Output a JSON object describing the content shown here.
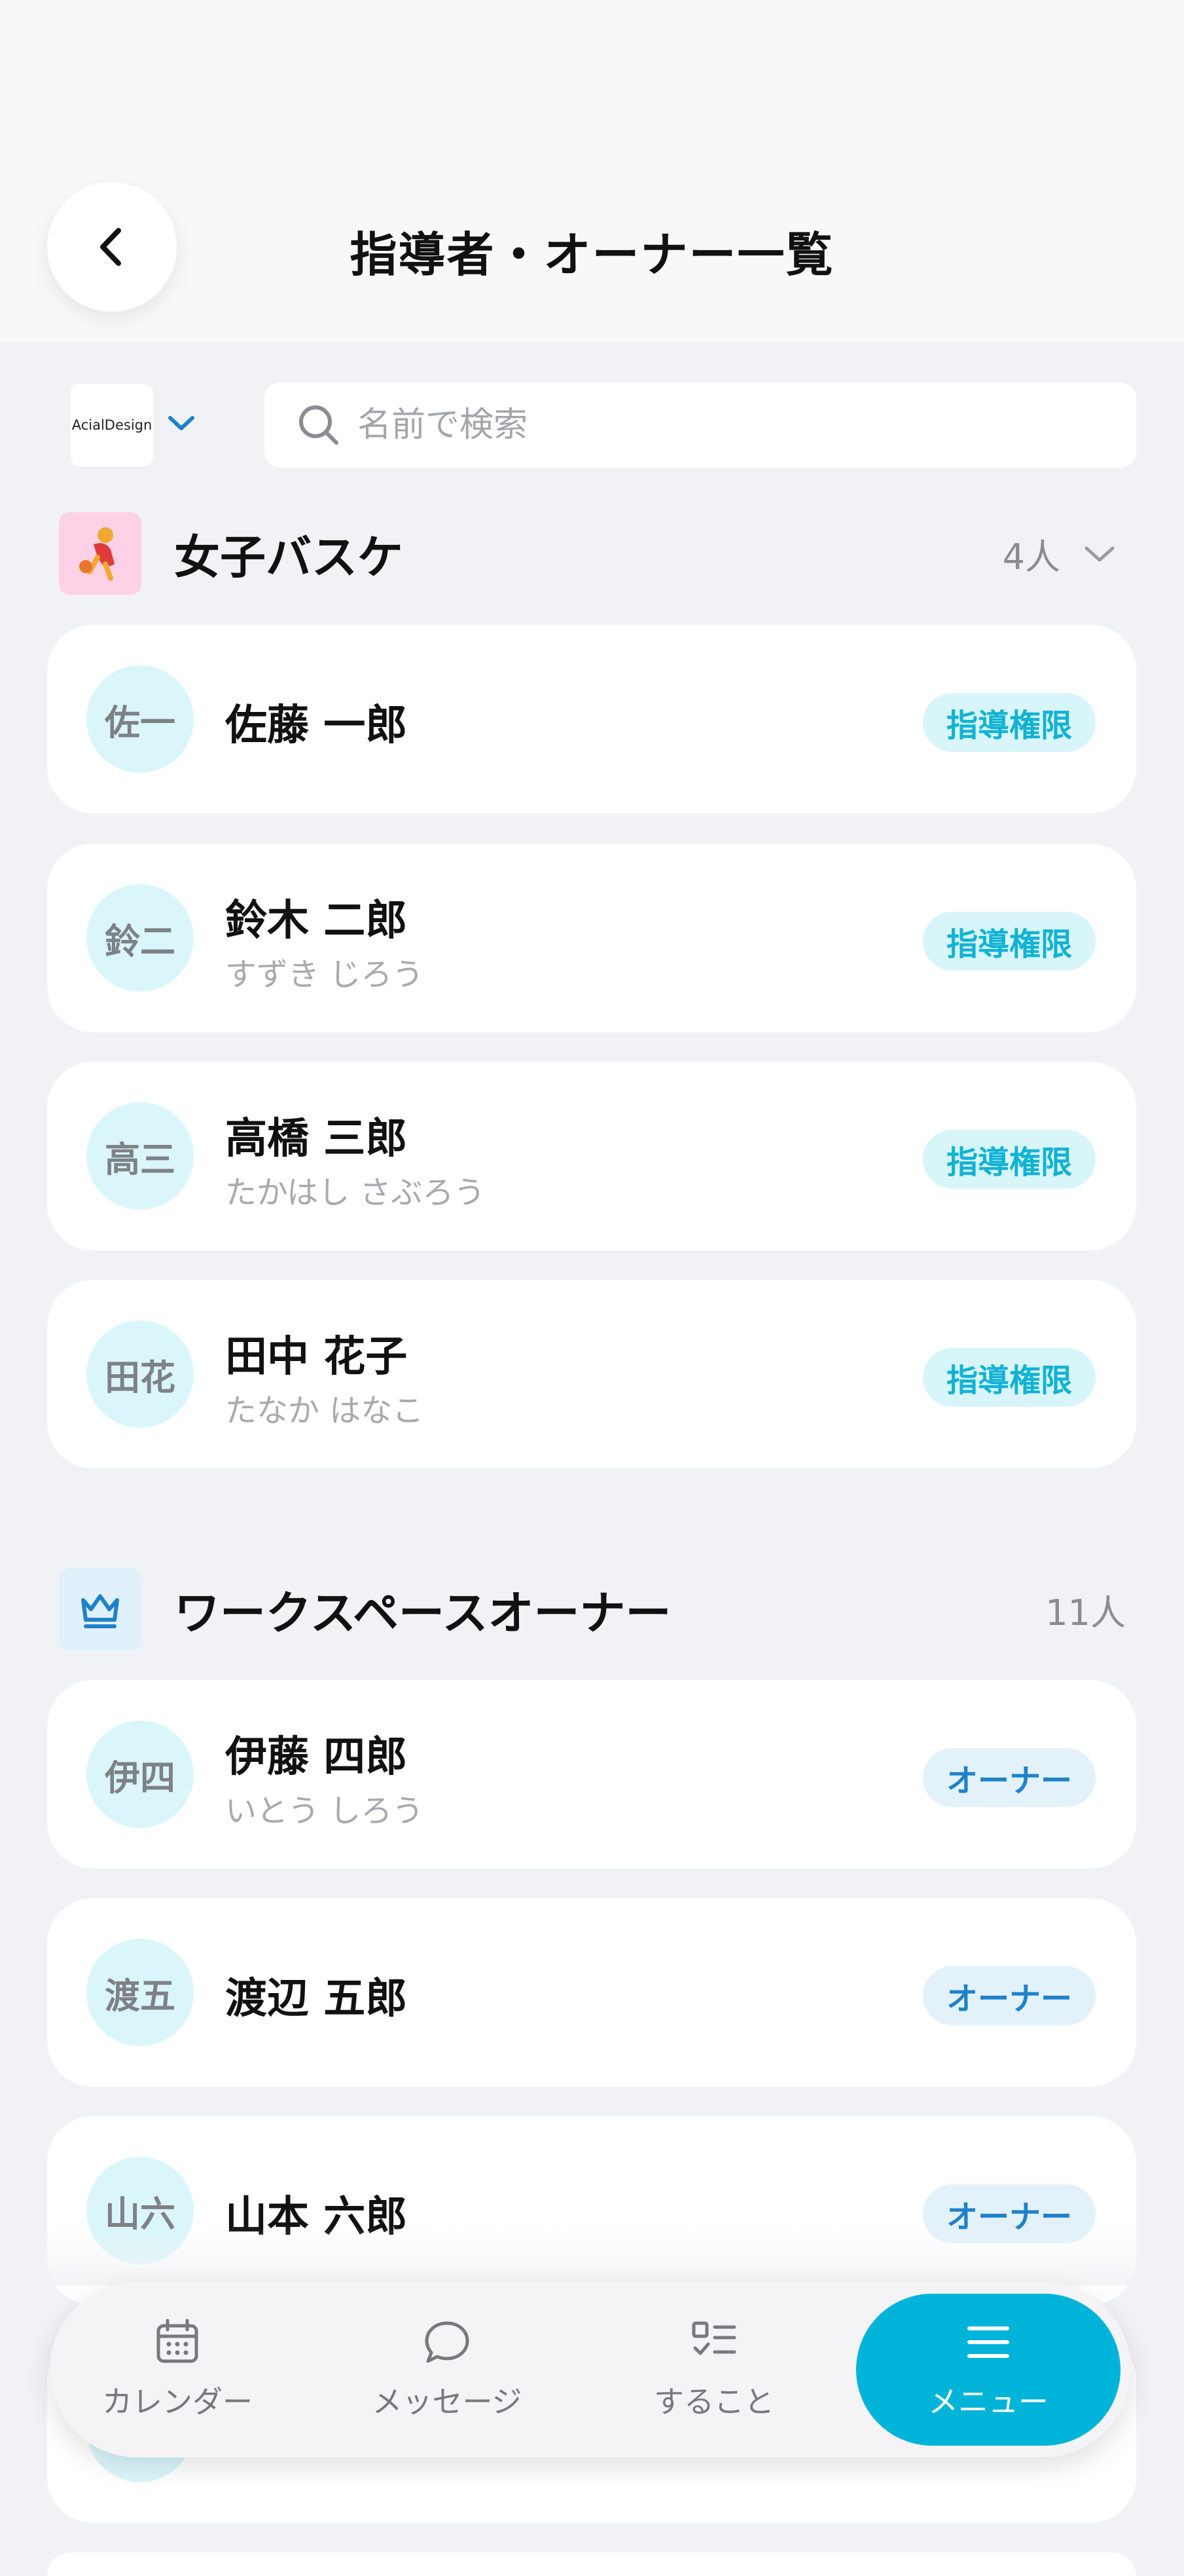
{
  "header": {
    "title": "指導者・オーナー一覧"
  },
  "filter": {
    "workspace_logo_text": "AcialDesign",
    "search_placeholder": "名前で検索"
  },
  "groups": [
    {
      "title": "女子バスケ",
      "count": "4人",
      "members": [
        {
          "initials": "佐一",
          "name": "佐藤 一郎",
          "kana": "",
          "role": "指導権限"
        },
        {
          "initials": "鈴二",
          "name": "鈴木 二郎",
          "kana": "すずき じろう",
          "role": "指導権限"
        },
        {
          "initials": "高三",
          "name": "高橋 三郎",
          "kana": "たかはし さぶろう",
          "role": "指導権限"
        },
        {
          "initials": "田花",
          "name": "田中 花子",
          "kana": "たなか はなこ",
          "role": "指導権限"
        }
      ]
    },
    {
      "title": "ワークスペースオーナー",
      "count": "11人",
      "members": [
        {
          "initials": "伊四",
          "name": "伊藤 四郎",
          "kana": "いとう しろう",
          "role": "オーナー"
        },
        {
          "initials": "渡五",
          "name": "渡辺 五郎",
          "kana": "",
          "role": "オーナー"
        },
        {
          "initials": "山六",
          "name": "山本 六郎",
          "kana": "",
          "role": "オーナー"
        }
      ]
    }
  ],
  "nav": {
    "calendar": "カレンダー",
    "messages": "メッセージ",
    "todo": "すること",
    "menu": "メニュー"
  },
  "colors": {
    "accent": "#00b4d9",
    "coach_badge_text": "#11b3d3",
    "owner_badge_text": "#1e82c9",
    "avatar_bg": "#daf6fb"
  }
}
